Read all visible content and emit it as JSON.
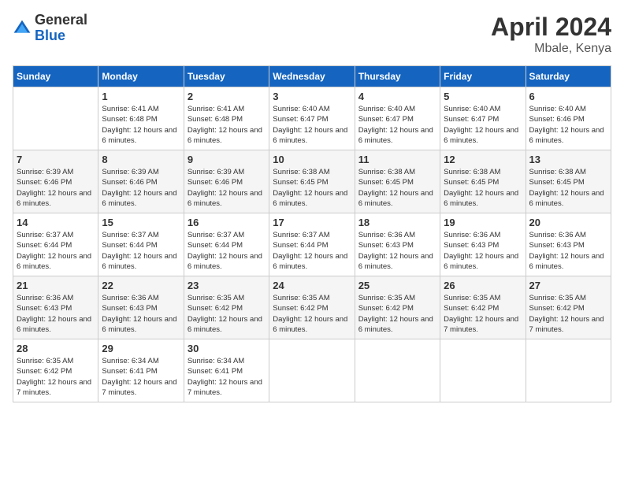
{
  "logo": {
    "general": "General",
    "blue": "Blue"
  },
  "title": "April 2024",
  "location": "Mbale, Kenya",
  "days_of_week": [
    "Sunday",
    "Monday",
    "Tuesday",
    "Wednesday",
    "Thursday",
    "Friday",
    "Saturday"
  ],
  "weeks": [
    [
      {
        "day": "",
        "sunrise": "",
        "sunset": "",
        "daylight": ""
      },
      {
        "day": "1",
        "sunrise": "Sunrise: 6:41 AM",
        "sunset": "Sunset: 6:48 PM",
        "daylight": "Daylight: 12 hours and 6 minutes."
      },
      {
        "day": "2",
        "sunrise": "Sunrise: 6:41 AM",
        "sunset": "Sunset: 6:48 PM",
        "daylight": "Daylight: 12 hours and 6 minutes."
      },
      {
        "day": "3",
        "sunrise": "Sunrise: 6:40 AM",
        "sunset": "Sunset: 6:47 PM",
        "daylight": "Daylight: 12 hours and 6 minutes."
      },
      {
        "day": "4",
        "sunrise": "Sunrise: 6:40 AM",
        "sunset": "Sunset: 6:47 PM",
        "daylight": "Daylight: 12 hours and 6 minutes."
      },
      {
        "day": "5",
        "sunrise": "Sunrise: 6:40 AM",
        "sunset": "Sunset: 6:47 PM",
        "daylight": "Daylight: 12 hours and 6 minutes."
      },
      {
        "day": "6",
        "sunrise": "Sunrise: 6:40 AM",
        "sunset": "Sunset: 6:46 PM",
        "daylight": "Daylight: 12 hours and 6 minutes."
      }
    ],
    [
      {
        "day": "7",
        "sunrise": "Sunrise: 6:39 AM",
        "sunset": "Sunset: 6:46 PM",
        "daylight": "Daylight: 12 hours and 6 minutes."
      },
      {
        "day": "8",
        "sunrise": "Sunrise: 6:39 AM",
        "sunset": "Sunset: 6:46 PM",
        "daylight": "Daylight: 12 hours and 6 minutes."
      },
      {
        "day": "9",
        "sunrise": "Sunrise: 6:39 AM",
        "sunset": "Sunset: 6:46 PM",
        "daylight": "Daylight: 12 hours and 6 minutes."
      },
      {
        "day": "10",
        "sunrise": "Sunrise: 6:38 AM",
        "sunset": "Sunset: 6:45 PM",
        "daylight": "Daylight: 12 hours and 6 minutes."
      },
      {
        "day": "11",
        "sunrise": "Sunrise: 6:38 AM",
        "sunset": "Sunset: 6:45 PM",
        "daylight": "Daylight: 12 hours and 6 minutes."
      },
      {
        "day": "12",
        "sunrise": "Sunrise: 6:38 AM",
        "sunset": "Sunset: 6:45 PM",
        "daylight": "Daylight: 12 hours and 6 minutes."
      },
      {
        "day": "13",
        "sunrise": "Sunrise: 6:38 AM",
        "sunset": "Sunset: 6:45 PM",
        "daylight": "Daylight: 12 hours and 6 minutes."
      }
    ],
    [
      {
        "day": "14",
        "sunrise": "Sunrise: 6:37 AM",
        "sunset": "Sunset: 6:44 PM",
        "daylight": "Daylight: 12 hours and 6 minutes."
      },
      {
        "day": "15",
        "sunrise": "Sunrise: 6:37 AM",
        "sunset": "Sunset: 6:44 PM",
        "daylight": "Daylight: 12 hours and 6 minutes."
      },
      {
        "day": "16",
        "sunrise": "Sunrise: 6:37 AM",
        "sunset": "Sunset: 6:44 PM",
        "daylight": "Daylight: 12 hours and 6 minutes."
      },
      {
        "day": "17",
        "sunrise": "Sunrise: 6:37 AM",
        "sunset": "Sunset: 6:44 PM",
        "daylight": "Daylight: 12 hours and 6 minutes."
      },
      {
        "day": "18",
        "sunrise": "Sunrise: 6:36 AM",
        "sunset": "Sunset: 6:43 PM",
        "daylight": "Daylight: 12 hours and 6 minutes."
      },
      {
        "day": "19",
        "sunrise": "Sunrise: 6:36 AM",
        "sunset": "Sunset: 6:43 PM",
        "daylight": "Daylight: 12 hours and 6 minutes."
      },
      {
        "day": "20",
        "sunrise": "Sunrise: 6:36 AM",
        "sunset": "Sunset: 6:43 PM",
        "daylight": "Daylight: 12 hours and 6 minutes."
      }
    ],
    [
      {
        "day": "21",
        "sunrise": "Sunrise: 6:36 AM",
        "sunset": "Sunset: 6:43 PM",
        "daylight": "Daylight: 12 hours and 6 minutes."
      },
      {
        "day": "22",
        "sunrise": "Sunrise: 6:36 AM",
        "sunset": "Sunset: 6:43 PM",
        "daylight": "Daylight: 12 hours and 6 minutes."
      },
      {
        "day": "23",
        "sunrise": "Sunrise: 6:35 AM",
        "sunset": "Sunset: 6:42 PM",
        "daylight": "Daylight: 12 hours and 6 minutes."
      },
      {
        "day": "24",
        "sunrise": "Sunrise: 6:35 AM",
        "sunset": "Sunset: 6:42 PM",
        "daylight": "Daylight: 12 hours and 6 minutes."
      },
      {
        "day": "25",
        "sunrise": "Sunrise: 6:35 AM",
        "sunset": "Sunset: 6:42 PM",
        "daylight": "Daylight: 12 hours and 6 minutes."
      },
      {
        "day": "26",
        "sunrise": "Sunrise: 6:35 AM",
        "sunset": "Sunset: 6:42 PM",
        "daylight": "Daylight: 12 hours and 7 minutes."
      },
      {
        "day": "27",
        "sunrise": "Sunrise: 6:35 AM",
        "sunset": "Sunset: 6:42 PM",
        "daylight": "Daylight: 12 hours and 7 minutes."
      }
    ],
    [
      {
        "day": "28",
        "sunrise": "Sunrise: 6:35 AM",
        "sunset": "Sunset: 6:42 PM",
        "daylight": "Daylight: 12 hours and 7 minutes."
      },
      {
        "day": "29",
        "sunrise": "Sunrise: 6:34 AM",
        "sunset": "Sunset: 6:41 PM",
        "daylight": "Daylight: 12 hours and 7 minutes."
      },
      {
        "day": "30",
        "sunrise": "Sunrise: 6:34 AM",
        "sunset": "Sunset: 6:41 PM",
        "daylight": "Daylight: 12 hours and 7 minutes."
      },
      {
        "day": "",
        "sunrise": "",
        "sunset": "",
        "daylight": ""
      },
      {
        "day": "",
        "sunrise": "",
        "sunset": "",
        "daylight": ""
      },
      {
        "day": "",
        "sunrise": "",
        "sunset": "",
        "daylight": ""
      },
      {
        "day": "",
        "sunrise": "",
        "sunset": "",
        "daylight": ""
      }
    ]
  ]
}
